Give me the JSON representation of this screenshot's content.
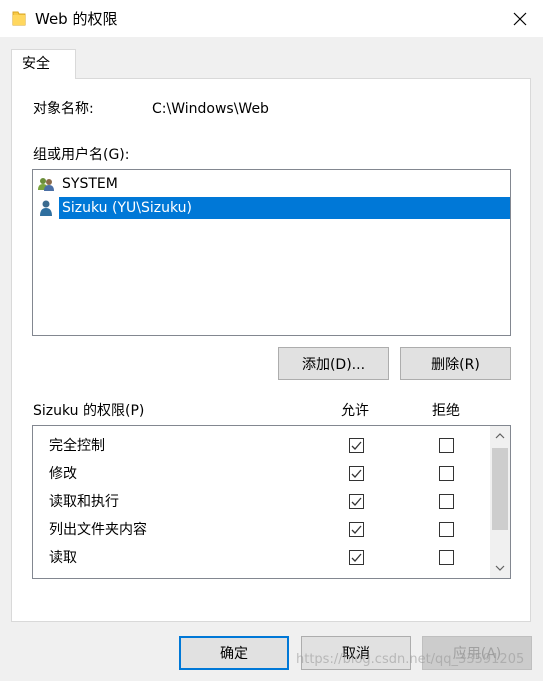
{
  "window": {
    "title": "Web 的权限",
    "icons": {
      "folder": "folder-icon",
      "close": "close-icon"
    }
  },
  "tabs": [
    {
      "label": "安全"
    }
  ],
  "object": {
    "label": "对象名称:",
    "value": "C:\\Windows\\Web"
  },
  "groups": {
    "label": "组或用户名(G):",
    "items": [
      {
        "name": "SYSTEM",
        "icon": "group-users-icon",
        "selected": false
      },
      {
        "name": "Sizuku (YU\\Sizuku)",
        "icon": "user-icon",
        "selected": true
      }
    ],
    "add_button": "添加(D)...",
    "remove_button": "删除(R)"
  },
  "permissions": {
    "label": "Sizuku 的权限(P)",
    "allow_header": "允许",
    "deny_header": "拒绝",
    "rows": [
      {
        "name": "完全控制",
        "allow": true,
        "deny": false
      },
      {
        "name": "修改",
        "allow": true,
        "deny": false
      },
      {
        "name": "读取和执行",
        "allow": true,
        "deny": false
      },
      {
        "name": "列出文件夹内容",
        "allow": true,
        "deny": false
      },
      {
        "name": "读取",
        "allow": true,
        "deny": false
      }
    ]
  },
  "footer": {
    "ok": "确定",
    "cancel": "取消",
    "apply": "应用(A)"
  },
  "watermark": "https://blog.csdn.net/qq_33591205",
  "colors": {
    "selection": "#0078d7",
    "window_bg": "#f0f0f0"
  }
}
